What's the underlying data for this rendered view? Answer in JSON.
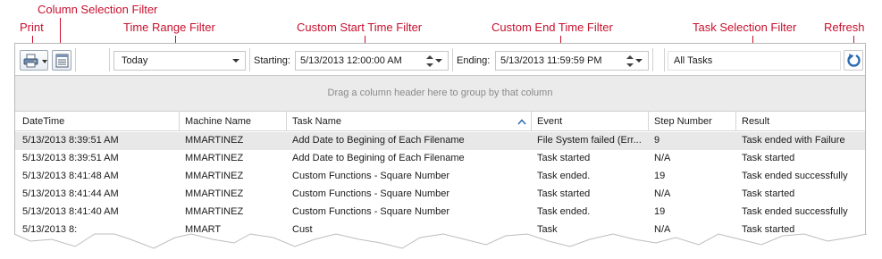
{
  "callouts": {
    "print": "Print",
    "column_selection": "Column Selection Filter",
    "time_range": "Time Range Filter",
    "custom_start": "Custom Start Time Filter",
    "custom_end": "Custom End Time Filter",
    "task_selection": "Task Selection Filter",
    "refresh": "Refresh"
  },
  "toolbar": {
    "time_range_value": "Today",
    "starting_label": "Starting:",
    "starting_value": "5/13/2013 12:00:00 AM",
    "ending_label": "Ending:",
    "ending_value": "5/13/2013 11:59:59 PM",
    "task_value": "All Tasks"
  },
  "group_hint": "Drag a column header here to group by that column",
  "columns": [
    "DateTime",
    "Machine Name",
    "Task Name",
    "Event",
    "Step Number",
    "Result"
  ],
  "rows": [
    [
      "5/13/2013 8:39:51 AM",
      "MMARTINEZ",
      "Add Date to Begining of Each Filename",
      "File System failed (Err...",
      "9",
      "Task ended with Failure"
    ],
    [
      "5/13/2013 8:39:51 AM",
      "MMARTINEZ",
      "Add Date to Begining of Each Filename",
      "Task started",
      "N/A",
      "Task started"
    ],
    [
      "5/13/2013 8:41:48 AM",
      "MMARTINEZ",
      "Custom Functions - Square Number",
      "Task ended.",
      "19",
      "Task ended successfully"
    ],
    [
      "5/13/2013 8:41:44 AM",
      "MMARTINEZ",
      "Custom Functions - Square Number",
      "Task started",
      "N/A",
      "Task started"
    ],
    [
      "5/13/2013 8:41:40 AM",
      "MMARTINEZ",
      "Custom Functions - Square Number",
      "Task ended.",
      "19",
      "Task ended successfully"
    ],
    [
      "5/13/2013 8:",
      "MMART",
      "Cust",
      "Task",
      "N/A",
      "Task started"
    ]
  ],
  "colors": {
    "callout": "#c8102e",
    "selected_row": "#e8e8e8",
    "refresh_icon": "#2b6cb0"
  },
  "icons": {
    "print": "printer-icon",
    "columns": "column-list-icon",
    "refresh": "refresh-icon",
    "sort": "sort-ascending-icon"
  }
}
